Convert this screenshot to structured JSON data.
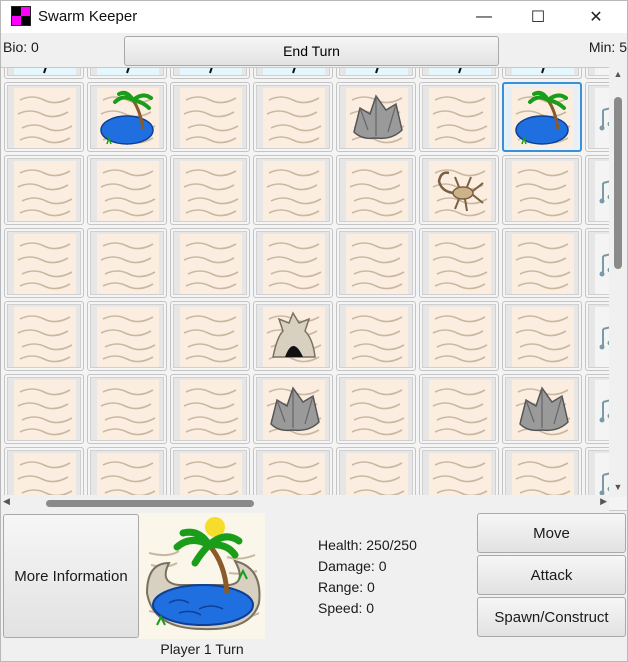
{
  "window": {
    "title": "Swarm Keeper",
    "controls": {
      "minimize": "—",
      "maximize": "☐",
      "close": "✕"
    }
  },
  "topbar": {
    "bio": "Bio: 0",
    "end_turn_label": "End Turn",
    "min": "Min: 5"
  },
  "map": {
    "rows": [
      [
        "ice",
        "ice",
        "ice",
        "ice",
        "ice",
        "ice",
        "ice",
        "music"
      ],
      [
        "sand",
        "oasis",
        "sand",
        "sand",
        "rock",
        "sand",
        "oasis",
        "music"
      ],
      [
        "sand",
        "sand",
        "sand",
        "sand",
        "sand",
        "scorpion",
        "sand",
        "music"
      ],
      [
        "sand",
        "sand",
        "sand",
        "sand",
        "sand",
        "sand",
        "sand",
        "music"
      ],
      [
        "sand",
        "sand",
        "sand",
        "hive",
        "sand",
        "sand",
        "sand",
        "music"
      ],
      [
        "sand",
        "sand",
        "sand",
        "rock",
        "sand",
        "sand",
        "rock",
        "music"
      ],
      [
        "sand",
        "sand",
        "sand",
        "sand",
        "sand",
        "sand",
        "sand",
        "music"
      ]
    ],
    "selected_tile": {
      "row": 1,
      "col": 6
    },
    "colors": {
      "sand": "#fbeee0",
      "sand_line": "#c9b8a0",
      "water": "#1f6fe0",
      "leaf": "#1a9e1a",
      "rock": "#9a9a9a",
      "selection": "#3a8fd6",
      "ice": "#e6f6fd"
    }
  },
  "selected": {
    "turn_label": "Player 1 Turn",
    "stats": {
      "health": "Health: 250/250",
      "damage": "Damage: 0",
      "range": "Range: 0",
      "speed": "Speed: 0"
    }
  },
  "buttons": {
    "more_info": "More Information",
    "move": "Move",
    "attack": "Attack",
    "spawn": "Spawn/Construct"
  },
  "icons": {
    "app": "swarm-keeper-app-icon",
    "scroll_up": "▲",
    "scroll_down": "▼",
    "scroll_left": "◀",
    "scroll_right": "▶"
  }
}
